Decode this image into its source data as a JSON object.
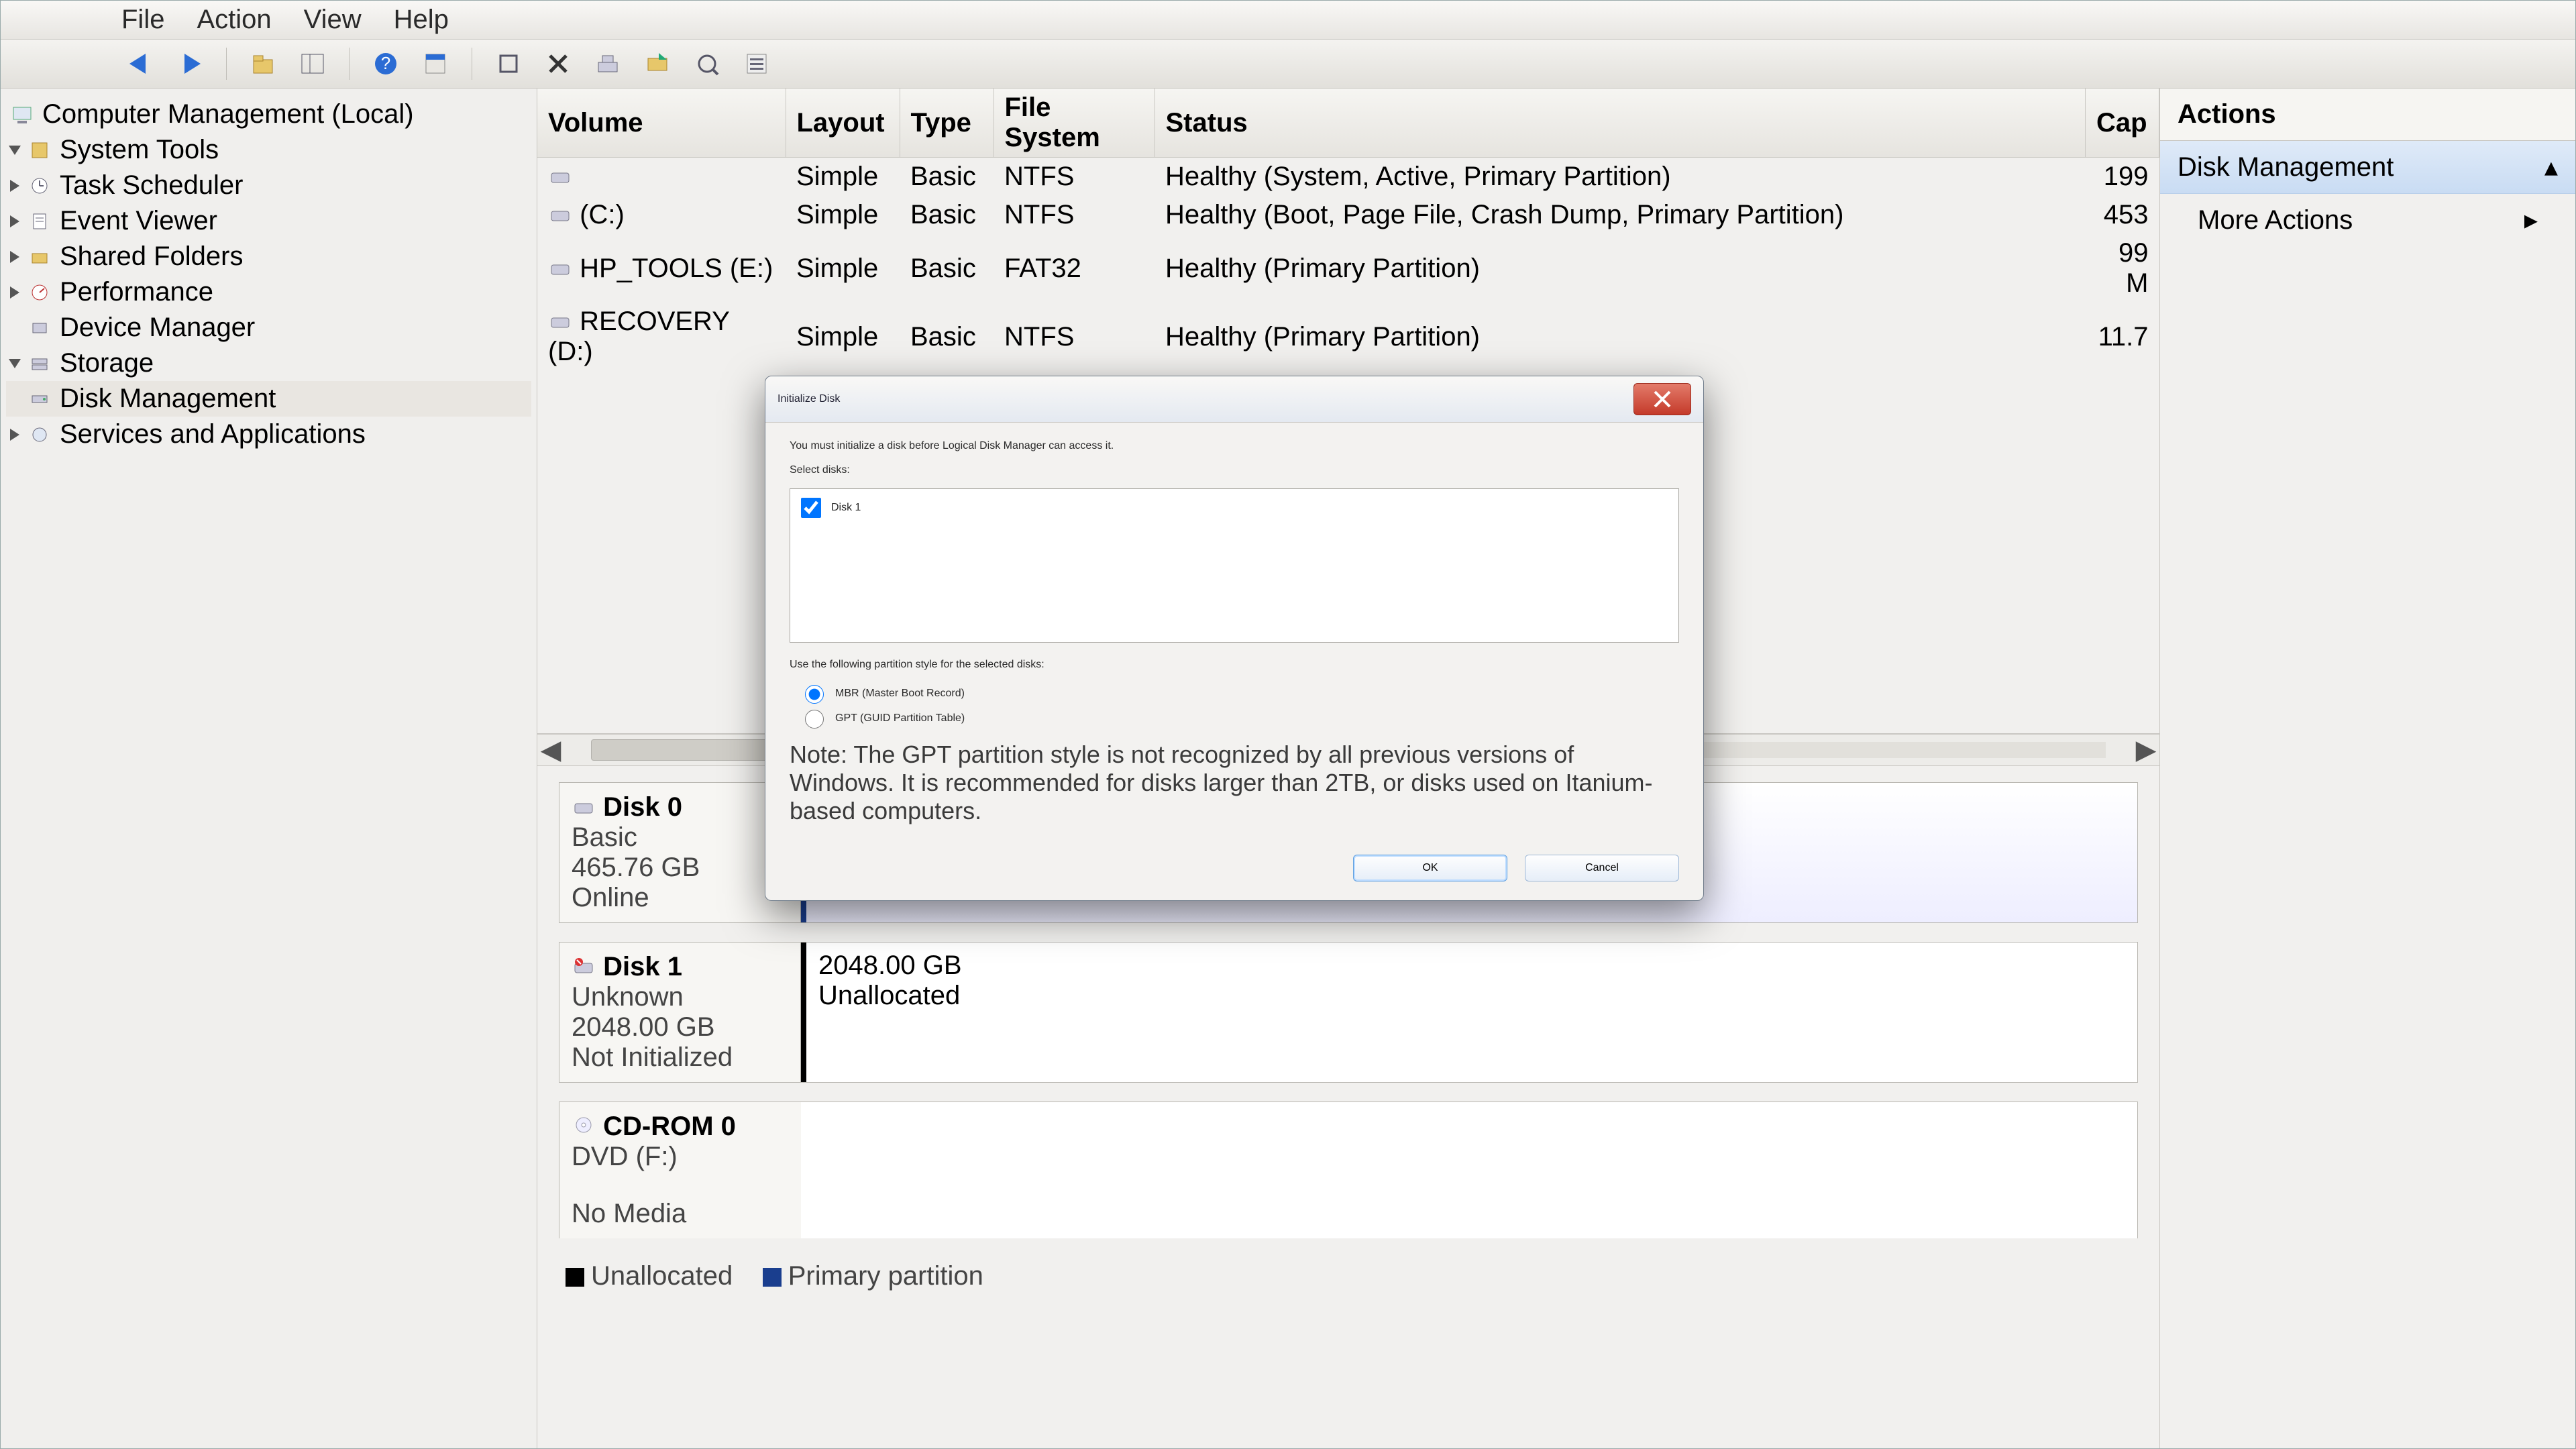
{
  "menu": {
    "file": "File",
    "action": "Action",
    "view": "View",
    "help": "Help"
  },
  "tree": {
    "root": "Computer Management (Local)",
    "system_tools": "System Tools",
    "task_scheduler": "Task Scheduler",
    "event_viewer": "Event Viewer",
    "shared_folders": "Shared Folders",
    "performance": "Performance",
    "device_manager": "Device Manager",
    "storage": "Storage",
    "disk_management": "Disk Management",
    "services_apps": "Services and Applications"
  },
  "volcols": {
    "volume": "Volume",
    "layout": "Layout",
    "type": "Type",
    "fs": "File System",
    "status": "Status",
    "cap": "Cap"
  },
  "volumes": [
    {
      "name": "",
      "layout": "Simple",
      "type": "Basic",
      "fs": "NTFS",
      "status": "Healthy (System, Active, Primary Partition)",
      "cap": "199"
    },
    {
      "name": "(C:)",
      "layout": "Simple",
      "type": "Basic",
      "fs": "NTFS",
      "status": "Healthy (Boot, Page File, Crash Dump, Primary Partition)",
      "cap": "453"
    },
    {
      "name": "HP_TOOLS (E:)",
      "layout": "Simple",
      "type": "Basic",
      "fs": "FAT32",
      "status": "Healthy (Primary Partition)",
      "cap": "99 M"
    },
    {
      "name": "RECOVERY (D:)",
      "layout": "Simple",
      "type": "Basic",
      "fs": "NTFS",
      "status": "Healthy (Primary Partition)",
      "cap": "11.7"
    }
  ],
  "disks": {
    "d0": {
      "title": "Disk 0",
      "type": "Basic",
      "size": "465.76 GB",
      "state": "Online"
    },
    "d1": {
      "title": "Disk 1",
      "type": "Unknown",
      "size": "2048.00 GB",
      "state": "Not Initialized",
      "part_size": "2048.00 GB",
      "part_state": "Unallocated"
    },
    "cd": {
      "title": "CD-ROM 0",
      "type": "DVD (F:)",
      "state": "No Media"
    }
  },
  "legend": {
    "unalloc": "Unallocated",
    "primary": "Primary partition"
  },
  "actions": {
    "header": "Actions",
    "group": "Disk Management",
    "more": "More Actions"
  },
  "dialog": {
    "title": "Initialize Disk",
    "intro": "You must initialize a disk before Logical Disk Manager can access it.",
    "select_label": "Select disks:",
    "disk_item": "Disk 1",
    "style_label": "Use the following partition style for the selected disks:",
    "mbr": "MBR (Master Boot Record)",
    "gpt": "GPT (GUID Partition Table)",
    "note": "Note: The GPT partition style is not recognized by all previous versions of Windows. It is recommended for disks larger than 2TB, or disks used on Itanium-based computers.",
    "ok": "OK",
    "cancel": "Cancel"
  }
}
